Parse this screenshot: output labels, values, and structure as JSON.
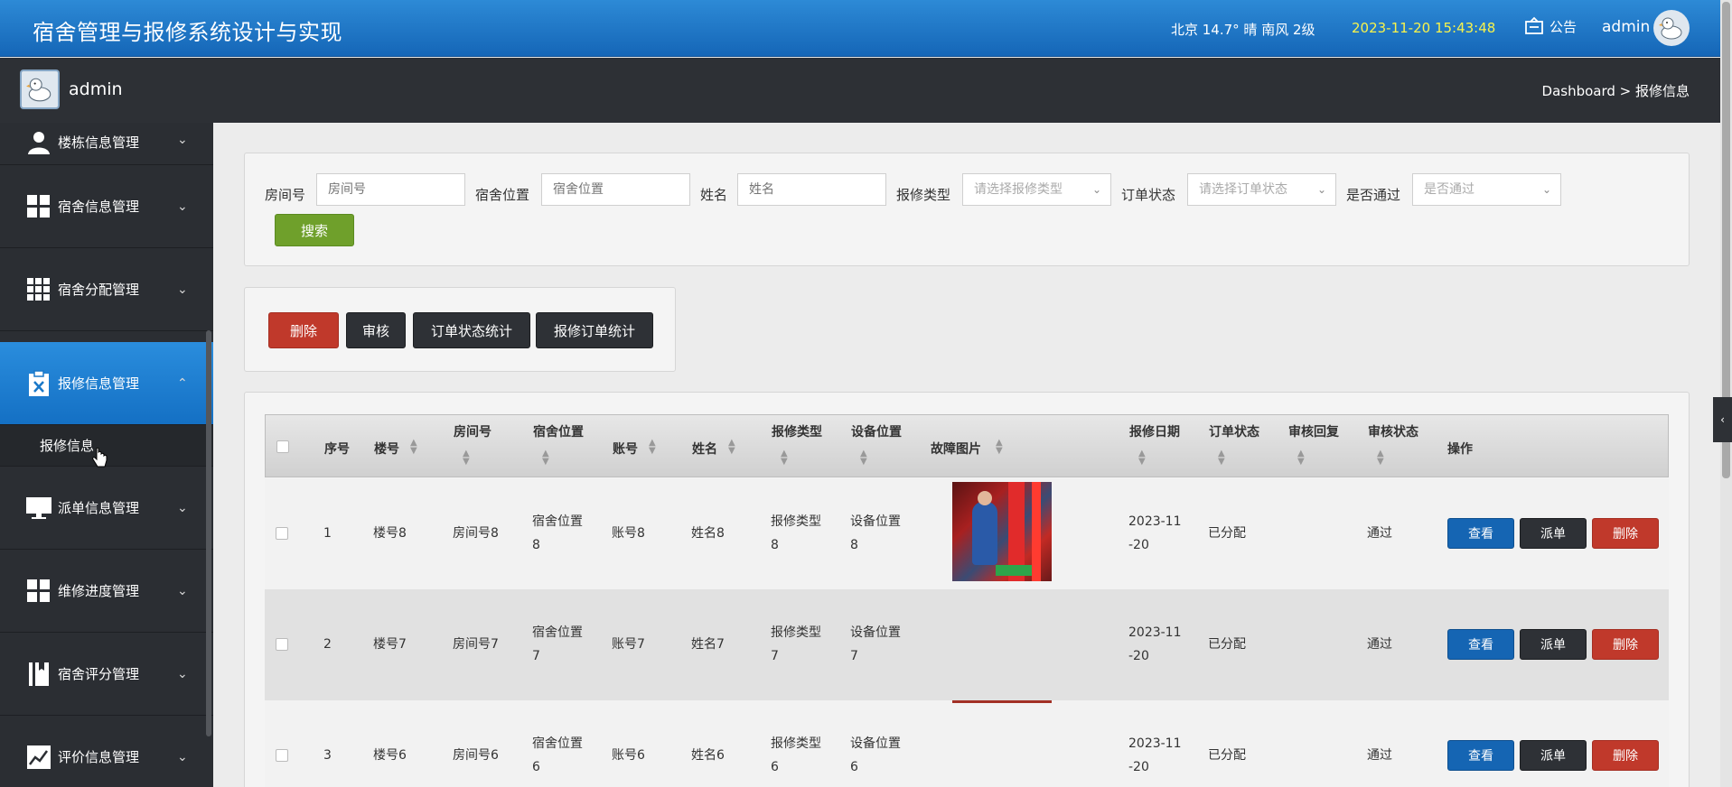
{
  "header": {
    "title": "宿舍管理与报修系统设计与实现",
    "weather": "北京 14.7° 晴 南风 2级",
    "datetime": "2023-11-20 15:43:48",
    "notice": "公告",
    "user": "admin"
  },
  "subbar": {
    "username": "admin",
    "breadcrumb": "Dashboard > 报修信息"
  },
  "sidebar": {
    "items": [
      {
        "label": "楼栋信息管理",
        "icon": "user-icon"
      },
      {
        "label": "宿舍信息管理",
        "icon": "grid-icon"
      },
      {
        "label": "宿舍分配管理",
        "icon": "grid9-icon"
      },
      {
        "label": "报修信息管理",
        "icon": "clipboard-x-icon"
      },
      {
        "label": "派单信息管理",
        "icon": "monitor-icon"
      },
      {
        "label": "维修进度管理",
        "icon": "grid-icon"
      },
      {
        "label": "宿舍评分管理",
        "icon": "book-icon"
      },
      {
        "label": "评价信息管理",
        "icon": "chart-icon"
      }
    ],
    "sub_item": "报修信息"
  },
  "search": {
    "room_label": "房间号",
    "room_placeholder": "房间号",
    "location_label": "宿舍位置",
    "location_placeholder": "宿舍位置",
    "name_label": "姓名",
    "name_placeholder": "姓名",
    "type_label": "报修类型",
    "type_placeholder": "请选择报修类型",
    "status_label": "订单状态",
    "status_placeholder": "请选择订单状态",
    "pass_label": "是否通过",
    "pass_placeholder": "是否通过",
    "search_button": "搜索"
  },
  "actions": {
    "delete": "删除",
    "review": "审核",
    "status_stats": "订单状态统计",
    "order_stats": "报修订单统计"
  },
  "table": {
    "headers": {
      "index": "序号",
      "building": "楼号",
      "room": "房间号",
      "location": "宿舍位置",
      "account": "账号",
      "name": "姓名",
      "type": "报修类型",
      "device": "设备位置",
      "photo": "故障图片",
      "date": "报修日期",
      "status": "订单状态",
      "reply": "审核回复",
      "review": "审核状态",
      "ops": "操作"
    },
    "rows": [
      {
        "index": "1",
        "building": "楼号8",
        "room": "房间号8",
        "location_1": "宿舍位置",
        "location_2": "8",
        "account": "账号8",
        "name": "姓名8",
        "type_1": "报修类型",
        "type_2": "8",
        "device_1": "设备位置",
        "device_2": "8",
        "date_1": "2023-11",
        "date_2": "-20",
        "status": "已分配",
        "review": "通过"
      },
      {
        "index": "2",
        "building": "楼号7",
        "room": "房间号7",
        "location_1": "宿舍位置",
        "location_2": "7",
        "account": "账号7",
        "name": "姓名7",
        "type_1": "报修类型",
        "type_2": "7",
        "device_1": "设备位置",
        "device_2": "7",
        "date_1": "2023-11",
        "date_2": "-20",
        "status": "已分配",
        "review": "通过"
      },
      {
        "index": "3",
        "building": "楼号6",
        "room": "房间号6",
        "location_1": "宿舍位置",
        "location_2": "6",
        "account": "账号6",
        "name": "姓名6",
        "type_1": "报修类型",
        "type_2": "6",
        "device_1": "设备位置",
        "device_2": "6",
        "date_1": "2023-11",
        "date_2": "-20",
        "status": "已分配",
        "review": "通过"
      }
    ],
    "view_button": "查看",
    "dispatch_button": "派单",
    "delete_button": "删除"
  },
  "colors": {
    "header_blue": "#1f78c8",
    "dark": "#2b2e33",
    "search_green": "#6fa02b",
    "danger_red": "#c0392b",
    "primary_blue": "#1565b3",
    "datetime_yellow": "#f8f34b"
  }
}
